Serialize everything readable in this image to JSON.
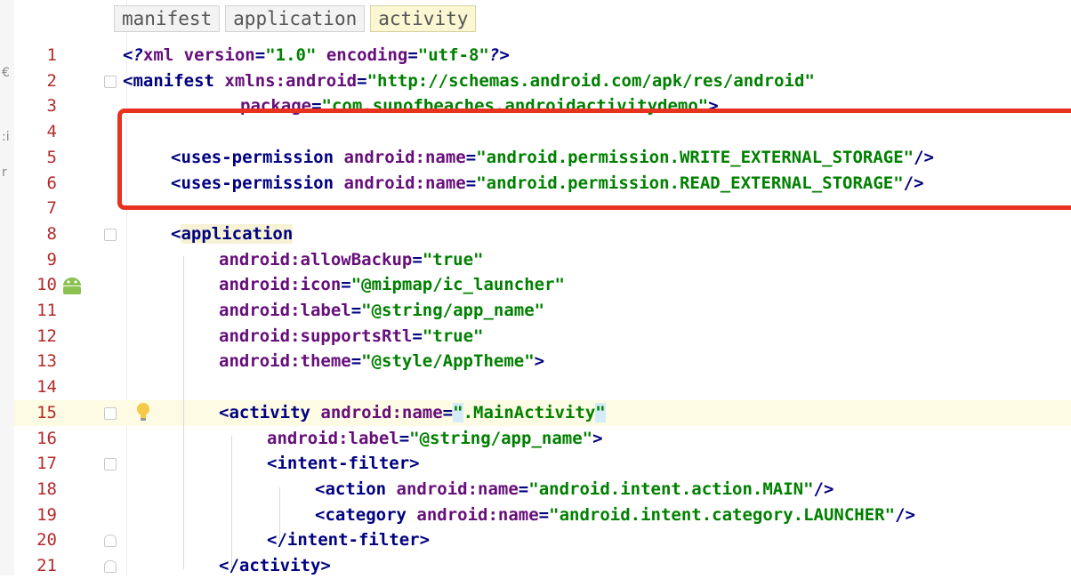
{
  "editor": {
    "breadcrumb_tabs": [
      "manifest",
      "application",
      "activity"
    ],
    "active_tab_index": 2,
    "current_line": 15,
    "highlight_color": "#e8321f",
    "line_number_color": "#b42a2a",
    "left_strip_glyphs": [
      "€",
      ":i",
      "r"
    ]
  },
  "lines": [
    {
      "n": "1",
      "tokens": [
        {
          "c": "pi",
          "t": "<?"
        },
        {
          "c": "t-attr",
          "t": "xml "
        },
        {
          "c": "t-attr",
          "t": "version"
        },
        {
          "c": "t-tag",
          "t": "="
        },
        {
          "c": "t-val",
          "t": "\"1.0\""
        },
        {
          "c": "t-attr",
          "t": " encoding"
        },
        {
          "c": "t-tag",
          "t": "="
        },
        {
          "c": "t-val",
          "t": "\"utf-8\""
        },
        {
          "c": "pi",
          "t": "?>"
        }
      ]
    },
    {
      "n": "2",
      "tokens": [
        {
          "c": "t-tag",
          "t": "<manifest "
        },
        {
          "c": "t-ns",
          "t": "xmlns:android"
        },
        {
          "c": "t-tag",
          "t": "="
        },
        {
          "c": "t-val",
          "t": "\"http://schemas.android.com/apk/res/android\""
        }
      ]
    },
    {
      "n": "3",
      "tokens": [
        {
          "c": "t-attr",
          "t": "package"
        },
        {
          "c": "t-tag",
          "t": "="
        },
        {
          "c": "t-val",
          "t": "\"com.sunofbeaches.androidactivitydemo\""
        },
        {
          "c": "t-tag",
          "t": ">"
        }
      ]
    },
    {
      "n": "4",
      "tokens": []
    },
    {
      "n": "5",
      "tokens": [
        {
          "c": "t-tag",
          "t": "<uses-permission "
        },
        {
          "c": "t-ns",
          "t": "android:"
        },
        {
          "c": "t-attr",
          "t": "name"
        },
        {
          "c": "t-tag",
          "t": "="
        },
        {
          "c": "t-val",
          "t": "\"android.permission.WRITE_EXTERNAL_STORAGE\""
        },
        {
          "c": "t-tag",
          "t": "/>"
        }
      ]
    },
    {
      "n": "6",
      "tokens": [
        {
          "c": "t-tag",
          "t": "<uses-permission "
        },
        {
          "c": "t-ns",
          "t": "android:"
        },
        {
          "c": "t-attr",
          "t": "name"
        },
        {
          "c": "t-tag",
          "t": "="
        },
        {
          "c": "t-val",
          "t": "\"android.permission.READ_EXTERNAL_STORAGE\""
        },
        {
          "c": "t-tag",
          "t": "/>"
        }
      ]
    },
    {
      "n": "7",
      "tokens": []
    },
    {
      "n": "8",
      "tokens": [
        {
          "c": "t-tag",
          "t": "<"
        },
        {
          "c": "app",
          "t": "application"
        }
      ]
    },
    {
      "n": "9",
      "tokens": [
        {
          "c": "t-ns",
          "t": "android:"
        },
        {
          "c": "t-attr",
          "t": "allowBackup"
        },
        {
          "c": "t-tag",
          "t": "="
        },
        {
          "c": "t-val",
          "t": "\"true\""
        }
      ]
    },
    {
      "n": "10",
      "tokens": [
        {
          "c": "t-ns",
          "t": "android:"
        },
        {
          "c": "t-attr",
          "t": "icon"
        },
        {
          "c": "t-tag",
          "t": "="
        },
        {
          "c": "t-val",
          "t": "\"@mipmap/ic_launcher\""
        }
      ]
    },
    {
      "n": "11",
      "tokens": [
        {
          "c": "t-ns",
          "t": "android:"
        },
        {
          "c": "t-attr",
          "t": "label"
        },
        {
          "c": "t-tag",
          "t": "="
        },
        {
          "c": "t-val",
          "t": "\"@string/app_name\""
        }
      ]
    },
    {
      "n": "12",
      "tokens": [
        {
          "c": "t-ns",
          "t": "android:"
        },
        {
          "c": "t-attr",
          "t": "supportsRtl"
        },
        {
          "c": "t-tag",
          "t": "="
        },
        {
          "c": "t-val",
          "t": "\"true\""
        }
      ]
    },
    {
      "n": "13",
      "tokens": [
        {
          "c": "t-ns",
          "t": "android:"
        },
        {
          "c": "t-attr",
          "t": "theme"
        },
        {
          "c": "t-tag",
          "t": "="
        },
        {
          "c": "t-val",
          "t": "\"@style/AppTheme\""
        },
        {
          "c": "t-tag",
          "t": ">"
        }
      ]
    },
    {
      "n": "14",
      "tokens": []
    },
    {
      "n": "15",
      "tokens": [
        {
          "c": "t-tag",
          "t": "<activity "
        },
        {
          "c": "t-ns",
          "t": "android:"
        },
        {
          "c": "t-attr",
          "t": "name"
        },
        {
          "c": "t-tag",
          "t": "="
        },
        {
          "c": "hl",
          "t": "\""
        },
        {
          "c": "t-val",
          "t": ".MainActivity"
        },
        {
          "c": "hl",
          "t": "\""
        }
      ]
    },
    {
      "n": "16",
      "tokens": [
        {
          "c": "t-ns",
          "t": "android:"
        },
        {
          "c": "t-attr",
          "t": "label"
        },
        {
          "c": "t-tag",
          "t": "="
        },
        {
          "c": "t-val",
          "t": "\"@string/app_name\""
        },
        {
          "c": "t-tag",
          "t": ">"
        }
      ]
    },
    {
      "n": "17",
      "tokens": [
        {
          "c": "t-tag",
          "t": "<intent-filter>"
        }
      ]
    },
    {
      "n": "18",
      "tokens": [
        {
          "c": "t-tag",
          "t": "<action "
        },
        {
          "c": "t-ns",
          "t": "android:"
        },
        {
          "c": "t-attr",
          "t": "name"
        },
        {
          "c": "t-tag",
          "t": "="
        },
        {
          "c": "t-val",
          "t": "\"android.intent.action.MAIN\""
        },
        {
          "c": "t-tag",
          "t": "/>"
        }
      ]
    },
    {
      "n": "19",
      "tokens": [
        {
          "c": "t-tag",
          "t": "<category "
        },
        {
          "c": "t-ns",
          "t": "android:"
        },
        {
          "c": "t-attr",
          "t": "name"
        },
        {
          "c": "t-tag",
          "t": "="
        },
        {
          "c": "t-val",
          "t": "\"android.intent.category.LAUNCHER\""
        },
        {
          "c": "t-tag",
          "t": "/>"
        }
      ]
    },
    {
      "n": "20",
      "tokens": [
        {
          "c": "t-tag",
          "t": "</intent-filter>"
        }
      ]
    },
    {
      "n": "21",
      "tokens": [
        {
          "c": "t-tag",
          "t": "</activity>"
        }
      ]
    }
  ]
}
